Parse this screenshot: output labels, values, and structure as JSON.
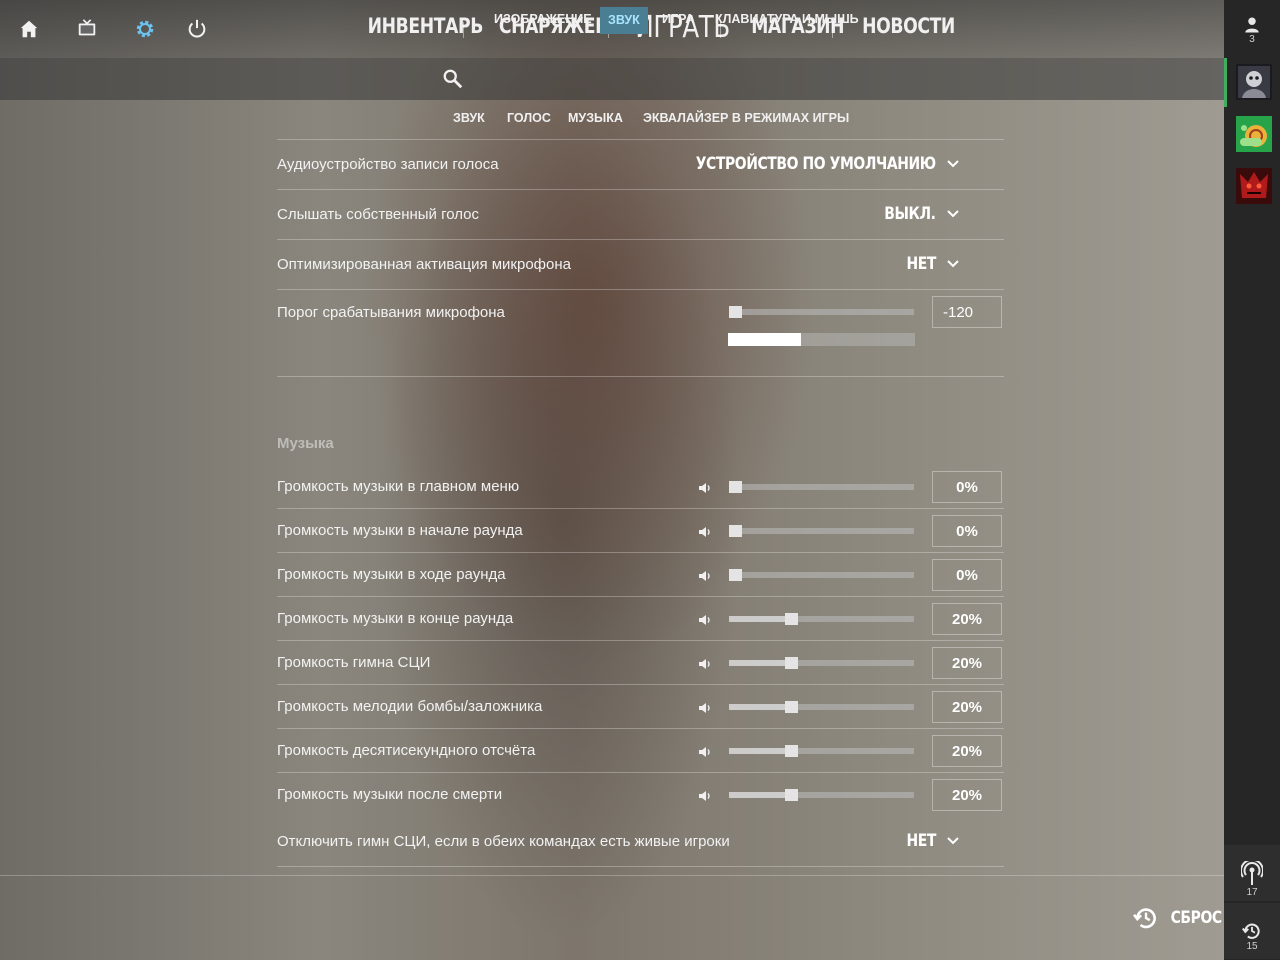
{
  "topnav": {
    "items": [
      "ИНВЕНТАРЬ",
      "СНАРЯЖЕНИЕ",
      "ИГРАТЬ",
      "МАГАЗИН",
      "НОВОСТИ"
    ]
  },
  "categories": {
    "items": [
      "ИЗОБРАЖЕНИЕ",
      "ЗВУК",
      "ИГРА",
      "КЛАВИАТУРА И МЫШЬ"
    ],
    "active": "ЗВУК"
  },
  "subtabs": [
    "ЗВУК",
    "ГОЛОС",
    "МУЗЫКА",
    "ЭКВАЛАЙЗЕР В РЕЖИМАХ ИГРЫ"
  ],
  "voice": {
    "device_label": "Аудиоустройство записи голоса",
    "device_value": "УСТРОЙСТВО ПО УМОЛЧАНИЮ",
    "hear_self_label": "Слышать собственный голос",
    "hear_self_value": "ВЫКЛ.",
    "optimized_label": "Оптимизированная активация микрофона",
    "optimized_value": "НЕТ",
    "threshold_label": "Порог срабатывания микрофона",
    "threshold_value": "-120",
    "threshold_slider_fraction": 0.0,
    "mic_level_fraction": 0.39
  },
  "music": {
    "section_title": "Музыка",
    "rows": [
      {
        "label": "Громкость музыки в главном меню",
        "value": "0%",
        "level": 0.0
      },
      {
        "label": "Громкость музыки в начале раунда",
        "value": "0%",
        "level": 0.0
      },
      {
        "label": "Громкость музыки в ходе раунда",
        "value": "0%",
        "level": 0.0
      },
      {
        "label": "Громкость музыки в конце раунда",
        "value": "20%",
        "level": 0.2
      },
      {
        "label": "Громкость гимна СЦИ",
        "value": "20%",
        "level": 0.2
      },
      {
        "label": "Громкость мелодии бомбы/заложника",
        "value": "20%",
        "level": 0.2
      },
      {
        "label": "Громкость десятисекундного отсчёта",
        "value": "20%",
        "level": 0.2
      },
      {
        "label": "Громкость музыки после смерти",
        "value": "20%",
        "level": 0.2
      }
    ],
    "disable_anthem_label": "Отключить гимн СЦИ, если в обеих командах есть живые игроки",
    "disable_anthem_value": "НЕТ"
  },
  "reset_label": "СБРОС",
  "sidebar": {
    "friends_count": "3",
    "broadcast_count": "17",
    "history_count": "15"
  },
  "colors": {
    "accent": "#4a7e93",
    "accent_text": "#a9e4ff",
    "online": "#3fae5f"
  }
}
